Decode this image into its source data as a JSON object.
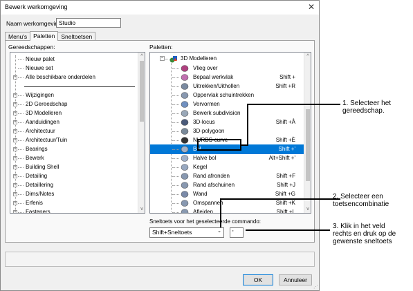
{
  "window": {
    "title": "Bewerk werkomgeving",
    "close_glyph": "✕"
  },
  "name_field": {
    "label": "Naam werkomgeving:",
    "value": "Studio"
  },
  "tabs": [
    {
      "label": "Menu's"
    },
    {
      "label": "Paletten"
    },
    {
      "label": "Sneltoetsen"
    }
  ],
  "tools": {
    "heading": "Gereedschappen:",
    "items": [
      {
        "label": "Nieuw palet",
        "expandable": false
      },
      {
        "label": "Nieuwe set",
        "expandable": false
      },
      {
        "label": "Alle beschikbare onderdelen",
        "expandable": true
      },
      {
        "label": "",
        "separator": true
      },
      {
        "label": "Wijzigingen",
        "expandable": true
      },
      {
        "label": "2D Gereedschap",
        "expandable": true
      },
      {
        "label": "3D Modelleren",
        "expandable": true
      },
      {
        "label": "Aanduidingen",
        "expandable": true
      },
      {
        "label": "Architectuur",
        "expandable": true
      },
      {
        "label": "Architectuur/Tuin",
        "expandable": true
      },
      {
        "label": "Bearings",
        "expandable": true
      },
      {
        "label": "Bewerk",
        "expandable": true
      },
      {
        "label": "Building Shell",
        "expandable": true
      },
      {
        "label": "Detailing",
        "expandable": true
      },
      {
        "label": "Detaillering",
        "expandable": true
      },
      {
        "label": "Dims/Notes",
        "expandable": true
      },
      {
        "label": "Erfenis",
        "expandable": true
      },
      {
        "label": "Fasteners",
        "expandable": true
      }
    ]
  },
  "palettes": {
    "heading": "Paletten:",
    "root": {
      "label": "3D Modelleren",
      "icon": "3d-modelling-icon"
    },
    "items": [
      {
        "label": "Vlieg over",
        "shortcut": "",
        "icon": "fly-over-icon",
        "color": "#b04080"
      },
      {
        "label": "Bepaal werkvlak",
        "shortcut": "Shift +",
        "icon": "working-plane-icon",
        "color": "#c070b0"
      },
      {
        "label": "Uitrekken/Uithollen",
        "shortcut": "Shift +R",
        "icon": "extrude-icon",
        "color": "#7a8aa0"
      },
      {
        "label": "Oppervlak schuintrekken",
        "shortcut": "",
        "icon": "taper-face-icon",
        "color": "#8898b0"
      },
      {
        "label": "Vervormen",
        "shortcut": "",
        "icon": "deform-icon",
        "color": "#7090c0"
      },
      {
        "label": "Bewerk subdivision",
        "shortcut": "",
        "icon": "subdivision-icon",
        "color": "#9aa8b8"
      },
      {
        "label": "3D-locus",
        "shortcut": "Shift +Å",
        "icon": "3d-locus-icon",
        "color": "#4a5a7a"
      },
      {
        "label": "3D-polygoon",
        "shortcut": "",
        "icon": "3d-polygon-icon",
        "color": "#7a8a9a"
      },
      {
        "label": "NURBS-curve",
        "shortcut": "Shift +È",
        "icon": "nurbs-curve-icon",
        "color": "#333333"
      },
      {
        "label": "Bol",
        "shortcut": "Shift +'",
        "icon": "sphere-icon",
        "color": "#a0b0c8",
        "selected": true
      },
      {
        "label": "Halve bol",
        "shortcut": "Alt+Shift +'",
        "icon": "hemisphere-icon",
        "color": "#a0b0c8"
      },
      {
        "label": "Kegel",
        "shortcut": "",
        "icon": "cone-icon",
        "color": "#98a8c0"
      },
      {
        "label": "Rand afronden",
        "shortcut": "Shift +F",
        "icon": "fillet-edge-icon",
        "color": "#8898b0"
      },
      {
        "label": "Rand afschuinen",
        "shortcut": "Shift +J",
        "icon": "chamfer-edge-icon",
        "color": "#8898b0"
      },
      {
        "label": "Wand",
        "shortcut": "Shift +G",
        "icon": "shell-icon",
        "color": "#7a8aa8"
      },
      {
        "label": "Omspannen",
        "shortcut": "Shift +K",
        "icon": "loft-icon",
        "color": "#8898b0"
      },
      {
        "label": "Afleiden",
        "shortcut": "Shift +L",
        "icon": "extract-icon",
        "color": "#8898b0"
      }
    ]
  },
  "shortcut_section": {
    "label": "Sneltoets voor het geselecteerde commando:",
    "modifier_value": "Shift+Sneltoets",
    "key_value": "'"
  },
  "buttons": {
    "ok": "OK",
    "cancel": "Annuleer"
  },
  "callouts": [
    {
      "text_line1": "1. Selecteer het",
      "text_line2": "gereedschap."
    },
    {
      "text_line1": "2. Selecteer een",
      "text_line2": "toetsencombinatie"
    },
    {
      "text_line1": "3. Klik in het veld",
      "text_line2": "rechts en druk op de",
      "text_line3": "gewenste sneltoets"
    }
  ]
}
